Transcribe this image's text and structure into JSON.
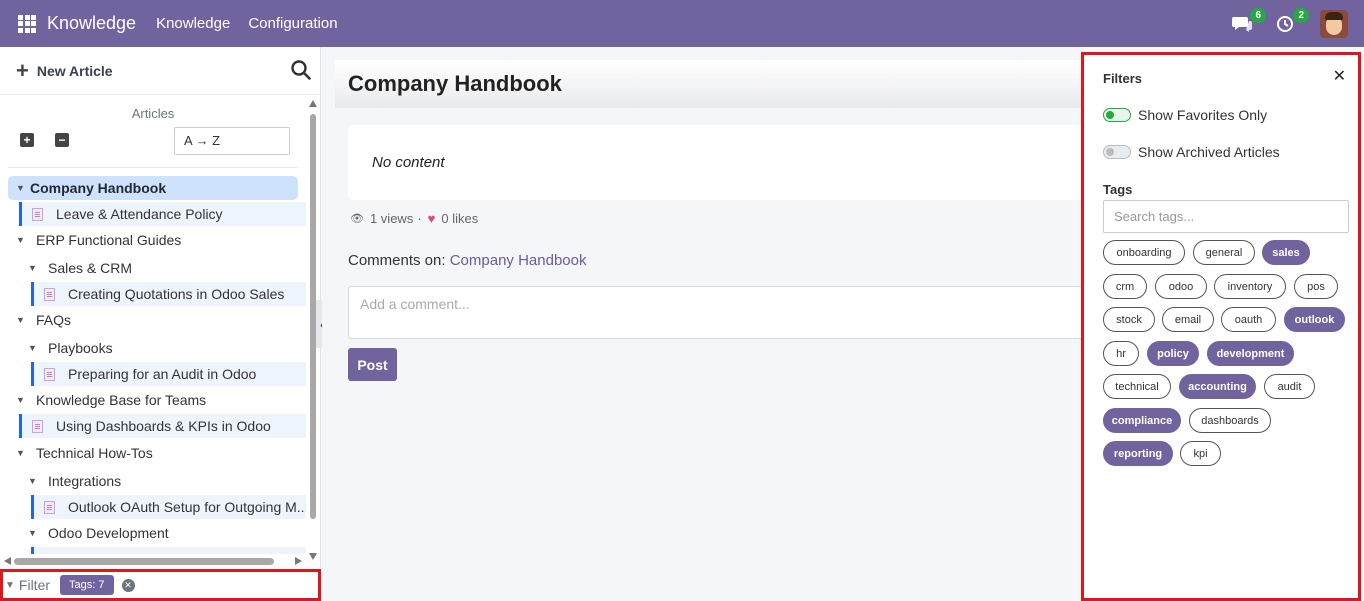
{
  "navbar": {
    "brand": "Knowledge",
    "menu": [
      "Knowledge",
      "Configuration"
    ],
    "messages_count": "6",
    "activities_count": "2"
  },
  "sidebar": {
    "new_article_label": "New Article",
    "articles_header": "Articles",
    "sort_label": "A → Z",
    "tree": [
      {
        "label": "Company Handbook",
        "type": "parent",
        "active": true
      },
      {
        "label": "Leave & Attendance Policy",
        "type": "child"
      },
      {
        "label": "ERP Functional Guides",
        "type": "parent"
      },
      {
        "label": "Sales & CRM",
        "type": "subparent"
      },
      {
        "label": "Creating Quotations in Odoo Sales",
        "type": "subchild"
      },
      {
        "label": "FAQs",
        "type": "parent"
      },
      {
        "label": "Playbooks",
        "type": "subparent"
      },
      {
        "label": "Preparing for an Audit in Odoo",
        "type": "subchild"
      },
      {
        "label": "Knowledge Base for Teams",
        "type": "parent"
      },
      {
        "label": "Using Dashboards & KPIs in Odoo",
        "type": "child"
      },
      {
        "label": "Technical How-Tos",
        "type": "parent"
      },
      {
        "label": "Integrations",
        "type": "subparent"
      },
      {
        "label": "Outlook OAuth Setup for Outgoing M...",
        "type": "subchild"
      },
      {
        "label": "Odoo Development",
        "type": "subparent"
      }
    ],
    "filter_label": "Filter",
    "filter_tag": "Tags: 7"
  },
  "main": {
    "title": "Company Handbook",
    "content_placeholder": "No content",
    "views": "1 views",
    "separator": "·",
    "likes": "0 likes",
    "comments_prefix": "Comments on:",
    "comments_article": "Company Handbook",
    "comment_placeholder": "Add a comment...",
    "post_label": "Post"
  },
  "filters": {
    "title": "Filters",
    "show_favorites": "Show Favorites Only",
    "favorites_on": true,
    "show_archived": "Show Archived Articles",
    "archived_on": false,
    "tags_label": "Tags",
    "tags_placeholder": "Search tags...",
    "tags": [
      {
        "label": "onboarding",
        "selected": false
      },
      {
        "label": "general",
        "selected": false
      },
      {
        "label": "sales",
        "selected": true
      },
      {
        "label": "crm",
        "selected": false
      },
      {
        "label": "odoo",
        "selected": false
      },
      {
        "label": "inventory",
        "selected": false
      },
      {
        "label": "pos",
        "selected": false
      },
      {
        "label": "stock",
        "selected": false
      },
      {
        "label": "email",
        "selected": false
      },
      {
        "label": "oauth",
        "selected": false
      },
      {
        "label": "outlook",
        "selected": true
      },
      {
        "label": "hr",
        "selected": false
      },
      {
        "label": "policy",
        "selected": true
      },
      {
        "label": "development",
        "selected": true
      },
      {
        "label": "technical",
        "selected": false
      },
      {
        "label": "accounting",
        "selected": true
      },
      {
        "label": "audit",
        "selected": false
      },
      {
        "label": "compliance",
        "selected": true
      },
      {
        "label": "dashboards",
        "selected": false
      },
      {
        "label": "reporting",
        "selected": true
      },
      {
        "label": "kpi",
        "selected": false
      }
    ]
  },
  "colors": {
    "brand": "#71639e",
    "highlight_border": "#e0161f",
    "badge_green": "#28a745",
    "active_tree_bg": "#cfe2fb"
  }
}
